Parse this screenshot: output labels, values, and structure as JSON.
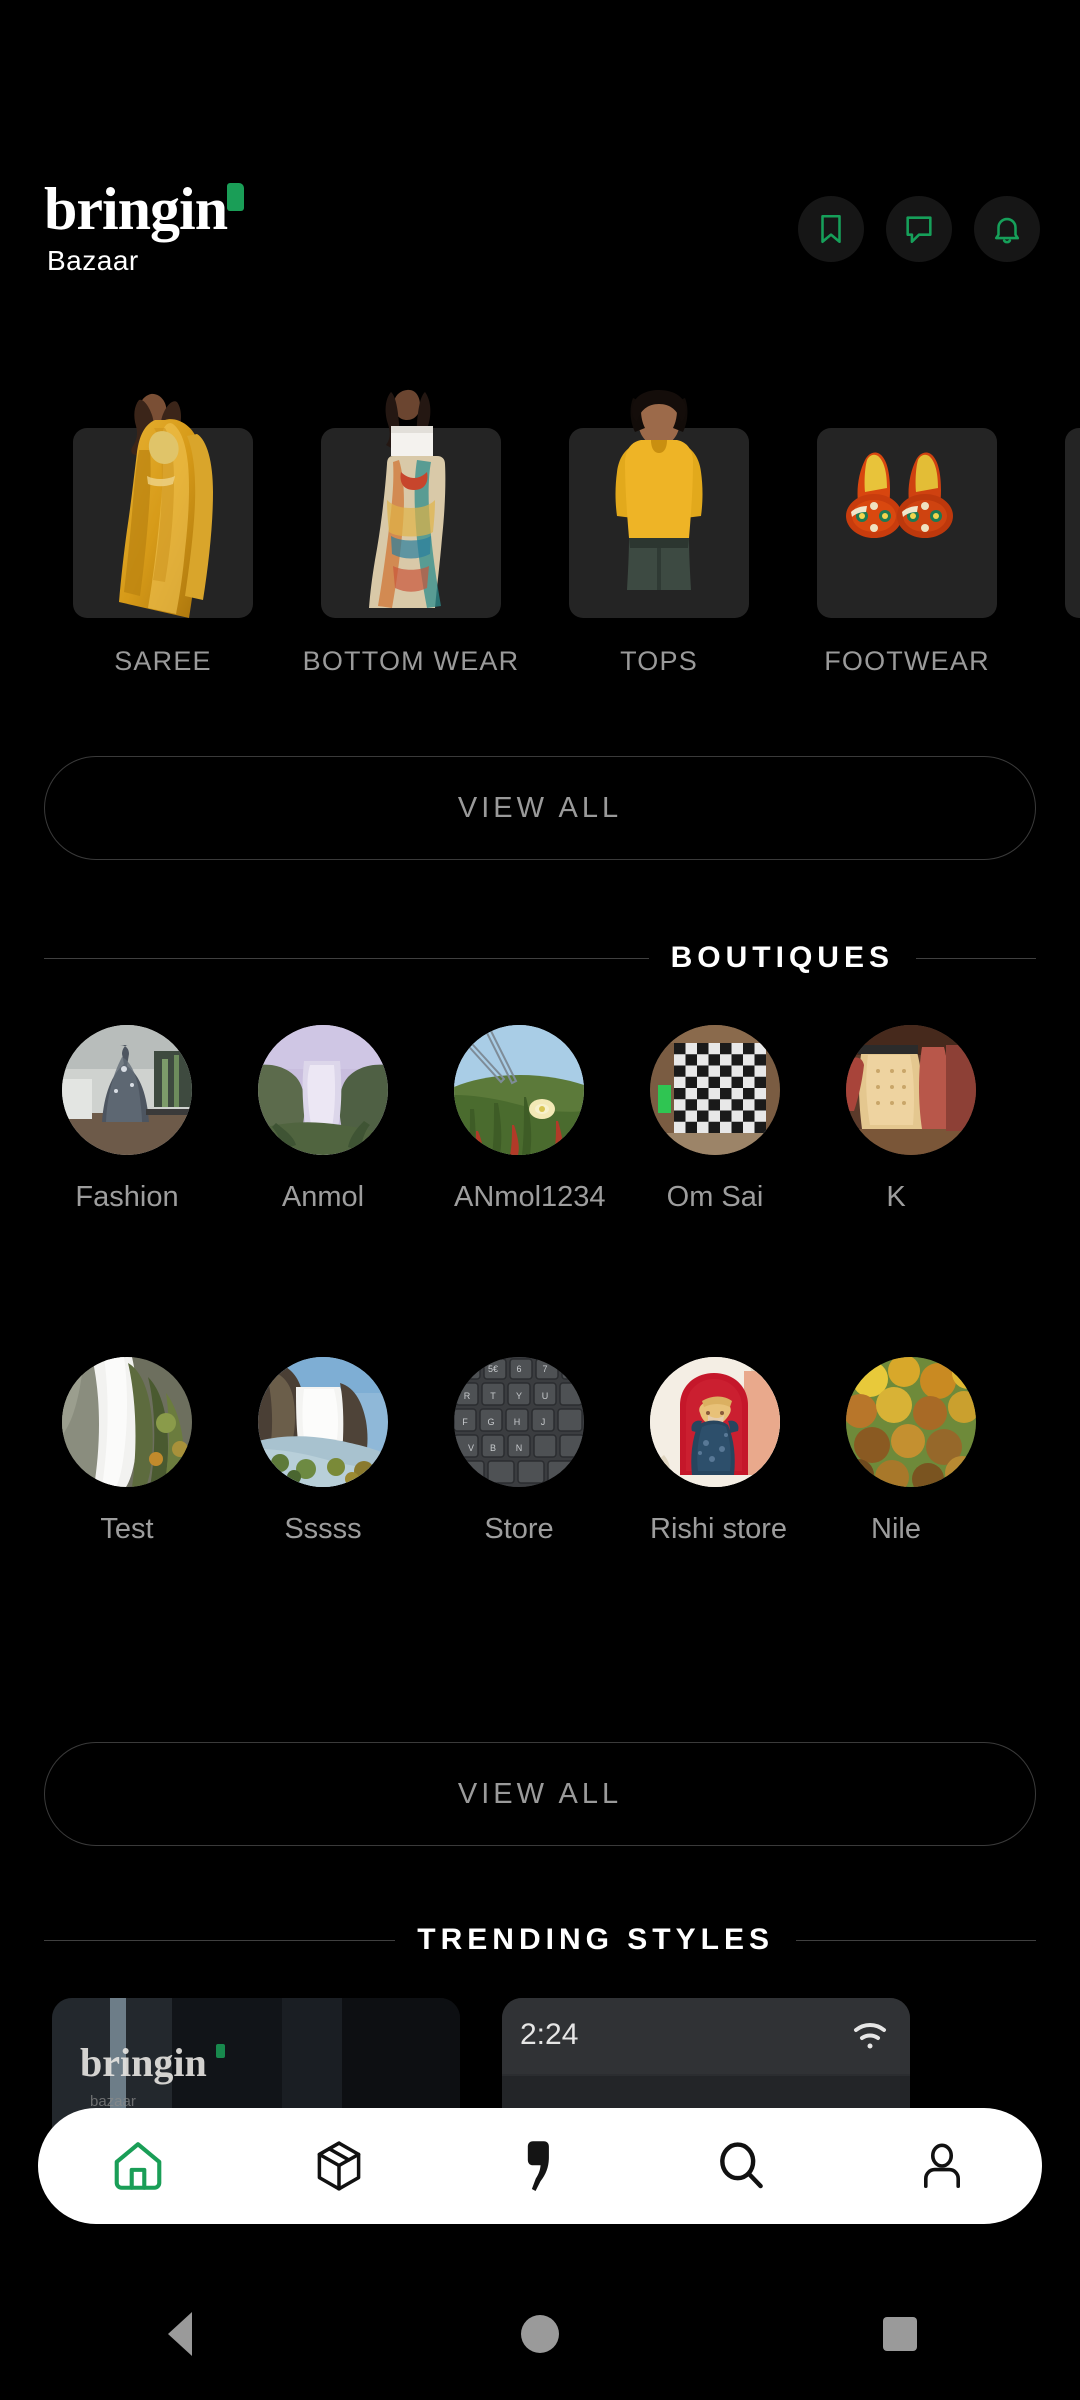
{
  "app": {
    "brand_word": "bringin",
    "brand_sub": "Bazaar",
    "accent_green": "#1a9e57",
    "background": "#000000",
    "card_background": "#242424"
  },
  "header": {
    "actions": [
      {
        "name": "bookmark-icon",
        "label": "Bookmarks"
      },
      {
        "name": "chat-icon",
        "label": "Messages"
      },
      {
        "name": "bell-icon",
        "label": "Notifications"
      }
    ]
  },
  "categories": {
    "items": [
      {
        "label": "SAREE"
      },
      {
        "label": "BOTTOM WEAR"
      },
      {
        "label": "TOPS"
      },
      {
        "label": "FOOTWEAR"
      },
      {
        "label": ""
      }
    ],
    "view_all_label": "VIEW ALL"
  },
  "boutiques": {
    "section_title": "BOUTIQUES",
    "row1": [
      {
        "label": "Fashion"
      },
      {
        "label": "Anmol"
      },
      {
        "label": "ANmol1234"
      },
      {
        "label": "Om Sai"
      },
      {
        "label": "K"
      }
    ],
    "row2": [
      {
        "label": "Test"
      },
      {
        "label": "Sssss"
      },
      {
        "label": "Store"
      },
      {
        "label": "Rishi store"
      },
      {
        "label": "Nile"
      }
    ],
    "view_all_label": "VIEW ALL"
  },
  "trending": {
    "section_title": "TRENDING STYLES",
    "cards": [
      {
        "overlay_text": "bringin"
      },
      {
        "status_time": "2:24"
      }
    ]
  },
  "bottom_nav": {
    "items": [
      {
        "name": "home-icon",
        "label": "Home",
        "active": true
      },
      {
        "name": "package-icon",
        "label": "Orders",
        "active": false
      },
      {
        "name": "brand-mark-icon",
        "label": "Bringin",
        "active": false
      },
      {
        "name": "search-icon",
        "label": "Search",
        "active": false
      },
      {
        "name": "profile-icon",
        "label": "Profile",
        "active": false
      }
    ]
  },
  "system_bar": {
    "back_label": "Back",
    "home_label": "Home",
    "recents_label": "Recents"
  }
}
